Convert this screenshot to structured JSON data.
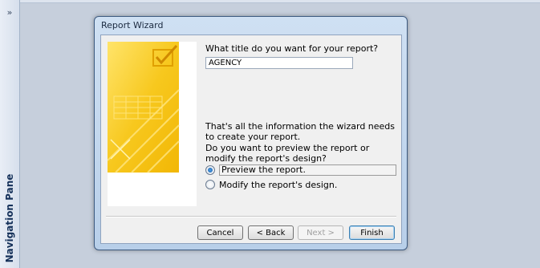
{
  "nav_pane": {
    "toggle_glyph": "»",
    "label": "Navigation Pane"
  },
  "dialog": {
    "title": "Report Wizard",
    "question_title": "What title do you want for your report?",
    "report_title_value": "AGENCY",
    "info_text": "That's all the information the wizard needs to create your report.",
    "preview_question": "Do you want to preview the report or modify the report's design?",
    "options": [
      {
        "label": "Preview the report.",
        "selected": true
      },
      {
        "label": "Modify the report's design.",
        "selected": false
      }
    ],
    "buttons": {
      "cancel": "Cancel",
      "back": "< Back",
      "next": "Next >",
      "finish": "Finish"
    }
  },
  "colors": {
    "art_yellow": "#f7c81e",
    "window_frame": "#b8cfe9",
    "radio_checked": "#1a5ea8"
  }
}
